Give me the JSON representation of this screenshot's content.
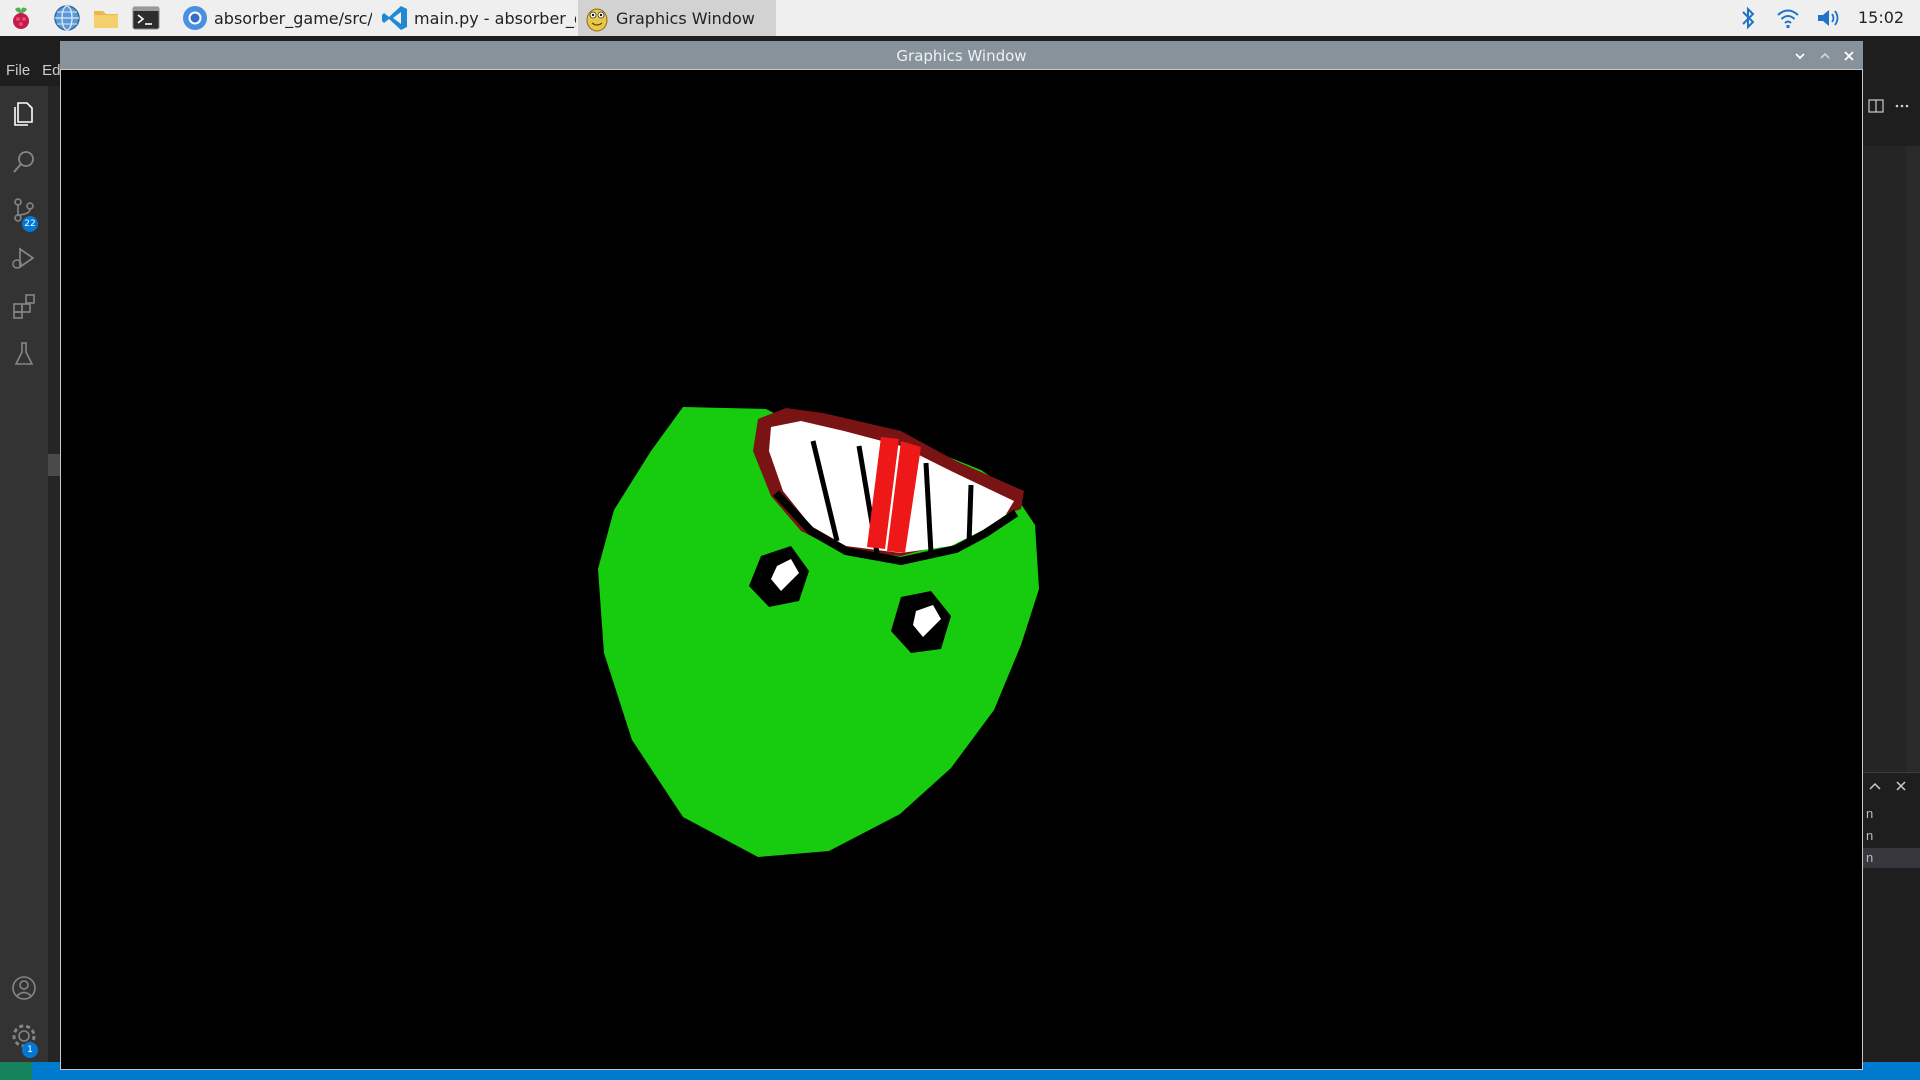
{
  "taskbar": {
    "tasks": [
      {
        "label": "absorber_game/src/..."
      },
      {
        "label": "main.py - absorber_g..."
      },
      {
        "label": "Graphics Window"
      }
    ],
    "clock": "15:02"
  },
  "vscode": {
    "menu": [
      "File",
      "Ed"
    ],
    "badges": {
      "source_control": "22",
      "settings": "1"
    },
    "panel_lines": [
      "n",
      "n",
      "n"
    ]
  },
  "graphics_window": {
    "title": "Graphics Window"
  },
  "colors": {
    "slime_green": "#17cc0e",
    "outline": "#000000",
    "teeth_white": "#ffffff",
    "red": "#ee1818",
    "dark_red": "#7a1414",
    "titlebar": "#87929a",
    "accent_blue": "#007acc"
  }
}
